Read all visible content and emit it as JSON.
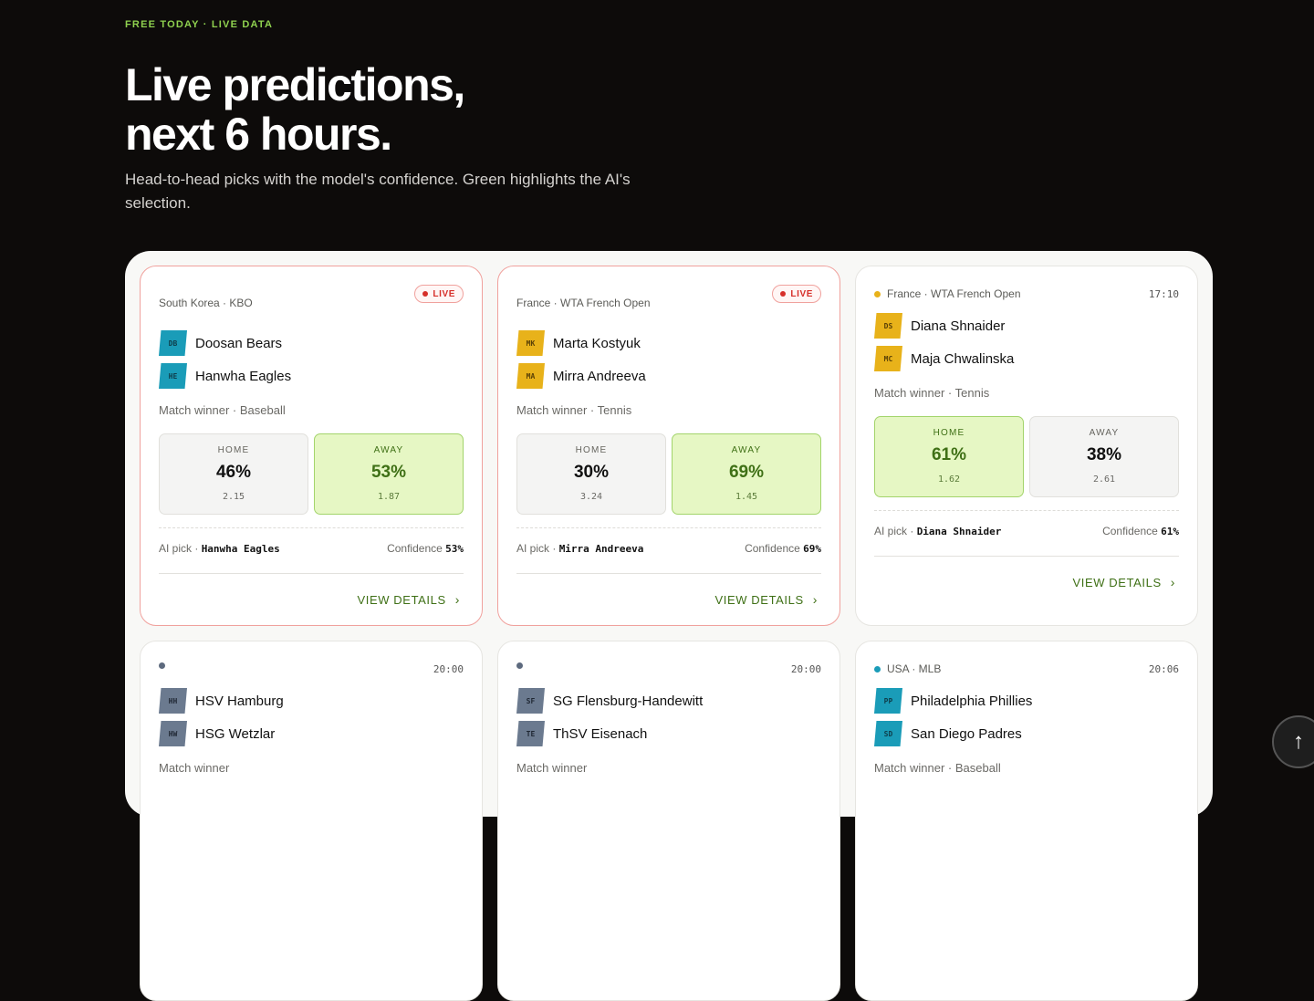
{
  "eyebrow": "FREE TODAY · LIVE DATA",
  "hero": {
    "title_line1": "Live predictions,",
    "title_line2": "next 6 hours.",
    "subtitle": "Head-to-head picks with the model's confidence. Green highlights the AI's selection."
  },
  "labels": {
    "live": "LIVE",
    "home": "HOME",
    "away": "AWAY",
    "ai_pick": "AI pick · ",
    "confidence": "Confidence ",
    "view_details": "VIEW DETAILS"
  },
  "cards": [
    {
      "league": "South Korea · KBO",
      "live": true,
      "home_team": {
        "abbr": "DB",
        "name": "Doosan Bears",
        "color": "#1a9cb8"
      },
      "away_team": {
        "abbr": "HE",
        "name": "Hanwha Eagles",
        "color": "#1a9cb8"
      },
      "market": "Match winner · Baseball",
      "home": {
        "pct": "46%",
        "odds": "2.15"
      },
      "away": {
        "pct": "53%",
        "odds": "1.87"
      },
      "selected": "away",
      "ai_pick": "Hanwha Eagles",
      "confidence": "53%"
    },
    {
      "league": "France · WTA French Open",
      "live": true,
      "home_team": {
        "abbr": "MK",
        "name": "Marta Kostyuk",
        "color": "#e8b21a"
      },
      "away_team": {
        "abbr": "MA",
        "name": "Mirra Andreeva",
        "color": "#e8b21a"
      },
      "market": "Match winner · Tennis",
      "home": {
        "pct": "30%",
        "odds": "3.24"
      },
      "away": {
        "pct": "69%",
        "odds": "1.45"
      },
      "selected": "away",
      "ai_pick": "Mirra Andreeva",
      "confidence": "69%"
    },
    {
      "league": "France · WTA French Open",
      "live": false,
      "time": "17:10",
      "dot_color": "#e8b21a",
      "home_team": {
        "abbr": "DS",
        "name": "Diana Shnaider",
        "color": "#e8b21a"
      },
      "away_team": {
        "abbr": "MC",
        "name": "Maja Chwalinska",
        "color": "#e8b21a"
      },
      "market": "Match winner · Tennis",
      "home": {
        "pct": "61%",
        "odds": "1.62"
      },
      "away": {
        "pct": "38%",
        "odds": "2.61"
      },
      "selected": "home",
      "ai_pick": "Diana Shnaider",
      "confidence": "61%"
    },
    {
      "league": "",
      "time": "20:00",
      "dot_color": "#5d6a7e",
      "home_team": {
        "abbr": "HH",
        "name": "HSV Hamburg",
        "color": "#6b7a8f"
      },
      "away_team": {
        "abbr": "HW",
        "name": "HSG Wetzlar",
        "color": "#6b7a8f"
      },
      "market": "Match winner"
    },
    {
      "league": "",
      "time": "20:00",
      "dot_color": "#5d6a7e",
      "home_team": {
        "abbr": "SF",
        "name": "SG Flensburg-Handewitt",
        "color": "#6b7a8f"
      },
      "away_team": {
        "abbr": "TE",
        "name": "ThSV Eisenach",
        "color": "#6b7a8f"
      },
      "market": "Match winner"
    },
    {
      "league": "USA · MLB",
      "time": "20:06",
      "dot_color": "#1a9cb8",
      "home_team": {
        "abbr": "PP",
        "name": "Philadelphia Phillies",
        "color": "#1a9cb8"
      },
      "away_team": {
        "abbr": "SD",
        "name": "San Diego Padres",
        "color": "#1a9cb8"
      },
      "market": "Match winner · Baseball"
    }
  ]
}
